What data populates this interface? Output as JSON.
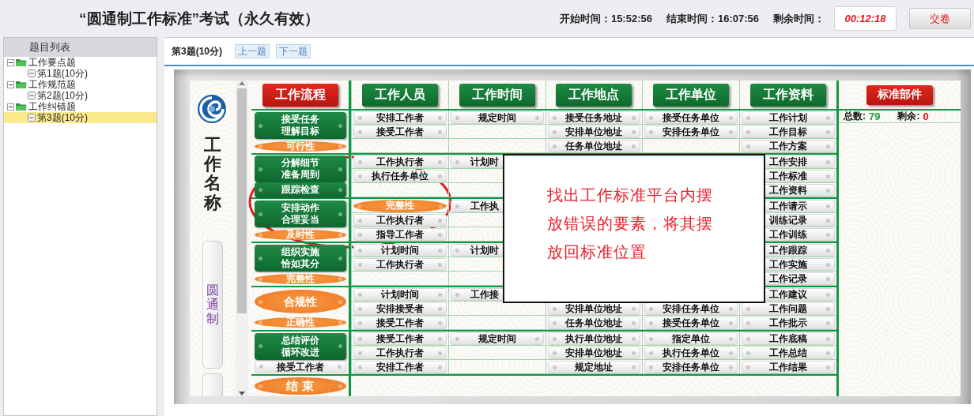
{
  "header": {
    "title": "“圆通制工作标准”考试（永久有效）",
    "times": [
      {
        "label": "开始时间：",
        "value": "15:52:56"
      },
      {
        "label": "结束时间：",
        "value": "16:07:56"
      }
    ],
    "remaining": {
      "label": "剩余时间：",
      "value": "00:12:18"
    },
    "submit": "交卷"
  },
  "sidebar": {
    "title": "题目列表",
    "tree": [
      {
        "label": "工作要点题",
        "expanded": true,
        "children": [
          {
            "label": "第1题(10分)",
            "selected": false
          }
        ]
      },
      {
        "label": "工作规范题",
        "expanded": true,
        "children": [
          {
            "label": "第2题(10分)",
            "selected": false
          }
        ]
      },
      {
        "label": "工作纠错题",
        "expanded": true,
        "children": [
          {
            "label": "第3题(10分)",
            "selected": true
          }
        ]
      }
    ]
  },
  "question": {
    "label": "第3题(10分)",
    "buttons": [
      "上一题",
      "下一题"
    ]
  },
  "board": {
    "side_title": "工作名称",
    "side_tab": "圆通制",
    "columns": [
      {
        "label": "工作流程",
        "kind": "red"
      },
      {
        "label": "工作人员",
        "kind": "green"
      },
      {
        "label": "工作时间",
        "kind": "green"
      },
      {
        "label": "工作地点",
        "kind": "green"
      },
      {
        "label": "工作单位",
        "kind": "green"
      },
      {
        "label": "工作资料",
        "kind": "green"
      }
    ],
    "parts": {
      "label": "标准部件",
      "stats": [
        {
          "label": "总数:",
          "value": "79",
          "color": "#1f9a3a"
        },
        {
          "label": "剩余:",
          "value": "0",
          "color": "#e8141c"
        }
      ]
    },
    "groups": [
      {
        "flow": [
          {
            "kind": "green",
            "lines": [
              "接受任务",
              "理解目标"
            ]
          },
          {
            "kind": "orange-small",
            "lines": [
              "可行性"
            ]
          }
        ],
        "rows": [
          [
            {
              "text": "安排工作者",
              "kind": "pill"
            },
            {
              "text": "规定时间",
              "kind": "pill"
            },
            {
              "text": "接受任务地址",
              "kind": "pill"
            },
            {
              "text": "接受任务单位",
              "kind": "pill"
            },
            {
              "text": "工作计划",
              "kind": "pill"
            }
          ],
          [
            {
              "text": "接受工作者",
              "kind": "pill"
            },
            null,
            {
              "text": "安排单位地址",
              "kind": "pill"
            },
            {
              "text": "安排任务单位",
              "kind": "pill"
            },
            {
              "text": "工作目标",
              "kind": "pill"
            }
          ],
          [
            null,
            null,
            {
              "text": "任务单位地址",
              "kind": "pill"
            },
            null,
            {
              "text": "工作方案",
              "kind": "pill"
            }
          ]
        ]
      },
      {
        "flow": [
          {
            "kind": "green",
            "lines": [
              "分解细节",
              "准备周到"
            ]
          },
          {
            "kind": "green",
            "lines": [
              "跟踪检查"
            ]
          }
        ],
        "rows": [
          [
            {
              "text": "工作执行者",
              "kind": "pill"
            },
            {
              "text": "计划时",
              "kind": "cut"
            },
            null,
            null,
            {
              "text": "工作安排",
              "kind": "pill"
            }
          ],
          [
            {
              "text": "执行任务单位",
              "kind": "pill"
            },
            null,
            null,
            null,
            {
              "text": "工作标准",
              "kind": "pill"
            }
          ],
          [
            null,
            null,
            null,
            null,
            {
              "text": "工作资料",
              "kind": "pill"
            }
          ]
        ]
      },
      {
        "flow": [
          {
            "kind": "green",
            "lines": [
              "安排动作",
              "合理妥当"
            ]
          },
          {
            "kind": "orange-small",
            "lines": [
              "及时性"
            ]
          }
        ],
        "rows": [
          [
            {
              "text": "完整性",
              "kind": "orange"
            },
            {
              "text": "工作执",
              "kind": "cut"
            },
            null,
            null,
            {
              "text": "工作请示",
              "kind": "pill"
            }
          ],
          [
            {
              "text": "工作执行者",
              "kind": "pill"
            },
            null,
            null,
            null,
            {
              "text": "训练记录",
              "kind": "pill"
            }
          ],
          [
            {
              "text": "指导工作者",
              "kind": "pill"
            },
            null,
            null,
            null,
            {
              "text": "工作训练",
              "kind": "pill"
            }
          ]
        ]
      },
      {
        "flow": [
          {
            "kind": "green",
            "lines": [
              "组织实施",
              "恰如其分"
            ]
          },
          {
            "kind": "orange-small",
            "lines": [
              "完整性"
            ]
          }
        ],
        "rows": [
          [
            {
              "text": "计划时间",
              "kind": "pill"
            },
            {
              "text": "计划时",
              "kind": "cut"
            },
            null,
            null,
            {
              "text": "工作跟踪",
              "kind": "pill"
            }
          ],
          [
            {
              "text": "工作执行者",
              "kind": "pill"
            },
            null,
            null,
            null,
            {
              "text": "工作实施",
              "kind": "pill"
            }
          ],
          [
            null,
            null,
            null,
            null,
            {
              "text": "工作记录",
              "kind": "pill"
            }
          ]
        ]
      },
      {
        "flow": [
          {
            "kind": "orange-big",
            "lines": [
              "合规性"
            ]
          },
          {
            "kind": "orange-small",
            "lines": [
              "正确性"
            ]
          }
        ],
        "rows": [
          [
            {
              "text": "计划时间",
              "kind": "pill"
            },
            {
              "text": "工作接",
              "kind": "cut"
            },
            null,
            null,
            {
              "text": "工作建议",
              "kind": "pill"
            }
          ],
          [
            {
              "text": "安排接受者",
              "kind": "pill"
            },
            null,
            {
              "text": "安排单位地址",
              "kind": "pill"
            },
            {
              "text": "安排任务单位",
              "kind": "pill"
            },
            {
              "text": "工作问题",
              "kind": "pill"
            }
          ],
          [
            {
              "text": "接受工作者",
              "kind": "pill"
            },
            null,
            {
              "text": "任务单位地址",
              "kind": "pill"
            },
            {
              "text": "接受任务单位",
              "kind": "pill"
            },
            {
              "text": "工作批示",
              "kind": "pill"
            }
          ]
        ]
      },
      {
        "flow": [
          {
            "kind": "green",
            "lines": [
              "总结评价",
              "循环改进"
            ]
          },
          {
            "kind": "white",
            "lines": [
              "接受工作者"
            ]
          }
        ],
        "rows": [
          [
            {
              "text": "接受工作者",
              "kind": "pill"
            },
            {
              "text": "规定时间",
              "kind": "pill"
            },
            {
              "text": "执行单位地址",
              "kind": "pill"
            },
            {
              "text": "指定单位",
              "kind": "pill"
            },
            {
              "text": "工作底稿",
              "kind": "pill"
            }
          ],
          [
            {
              "text": "工作执行者",
              "kind": "pill"
            },
            null,
            {
              "text": "安排单位地址",
              "kind": "pill"
            },
            {
              "text": "执行任务单位",
              "kind": "pill"
            },
            {
              "text": "工作总结",
              "kind": "pill"
            }
          ],
          [
            {
              "text": "安排工作者",
              "kind": "pill"
            },
            null,
            {
              "text": "规定地址",
              "kind": "pill"
            },
            {
              "text": "安排任务单位",
              "kind": "pill"
            },
            {
              "text": "工作结果",
              "kind": "pill"
            }
          ]
        ]
      }
    ],
    "end": "结 束"
  },
  "dialog": {
    "text": "找出工作标准平台内摆放错误的要素，将其摆放回标准位置"
  }
}
